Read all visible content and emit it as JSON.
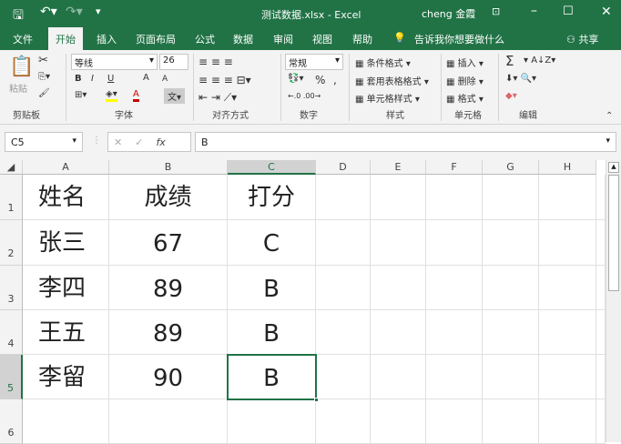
{
  "title": {
    "filename": "测试数据.xlsx",
    "sep": "-",
    "app": "Excel",
    "user": "cheng 金霞",
    "qat": [
      "save-icon",
      "undo-icon",
      "redo-icon",
      "customize-icon"
    ]
  },
  "tabs": [
    "文件",
    "开始",
    "插入",
    "页面布局",
    "公式",
    "数据",
    "审阅",
    "视图",
    "帮助"
  ],
  "tell_me": "告诉我你想要做什么",
  "share": "共享",
  "ribbon": {
    "paste": "粘贴",
    "font_name": "等线",
    "font_size": "26",
    "bold": "B",
    "italic": "I",
    "underline": "U",
    "grow": "A",
    "shrink": "A",
    "font_color": "A",
    "number_format": "常规",
    "percent": "%",
    "comma": ",",
    "cond_format": "条件格式 ▾",
    "table_format": "套用表格格式 ▾",
    "cell_style": "单元格样式 ▾",
    "insert": "插入",
    "delete": "删除",
    "format": "格式",
    "sum": "Σ",
    "groups": [
      "剪贴板",
      "字体",
      "对齐方式",
      "数字",
      "样式",
      "单元格",
      "编辑"
    ]
  },
  "formula": {
    "name_box": "C5",
    "value": "B",
    "fx": "fx",
    "cancel": "✕",
    "enter": "✓"
  },
  "colors": {
    "accent": "#217346",
    "selection": "#217346"
  },
  "columns": [
    "A",
    "B",
    "C",
    "D",
    "E",
    "F",
    "G",
    "H"
  ],
  "rows": [
    "1",
    "2",
    "3",
    "4",
    "5",
    "6"
  ],
  "cells": [
    [
      "姓名",
      "成绩",
      "打分"
    ],
    [
      "张三",
      "67",
      "C"
    ],
    [
      "李四",
      "89",
      "B"
    ],
    [
      "王五",
      "89",
      "B"
    ],
    [
      "李留",
      "90",
      "B"
    ]
  ],
  "active_cell": "C5"
}
